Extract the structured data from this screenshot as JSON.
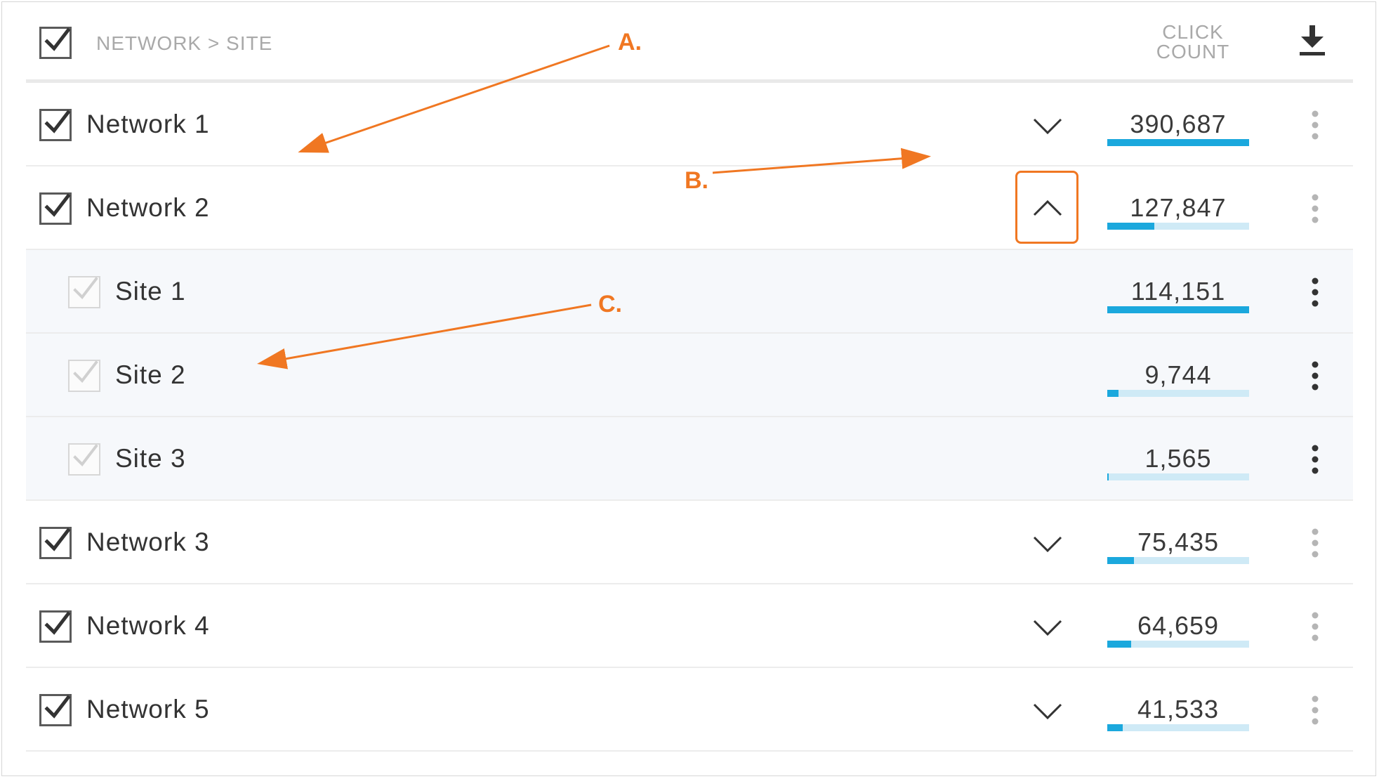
{
  "header": {
    "breadcrumb": "NETWORK > SITE",
    "count_line1": "CLICK",
    "count_line2": "COUNT",
    "download_icon": "download-icon"
  },
  "rows": [
    {
      "label": "Network 1",
      "count": "390,687",
      "share": 1.0,
      "type": "network",
      "expanded": false
    },
    {
      "label": "Network 2",
      "count": "127,847",
      "share": 0.33,
      "type": "network",
      "expanded": true
    },
    {
      "label": "Site 1",
      "count": "114,151",
      "share": 1.0,
      "type": "site"
    },
    {
      "label": "Site 2",
      "count": "9,744",
      "share": 0.08,
      "type": "site"
    },
    {
      "label": "Site 3",
      "count": "1,565",
      "share": 0.01,
      "type": "site"
    },
    {
      "label": "Network 3",
      "count": "75,435",
      "share": 0.19,
      "type": "network",
      "expanded": false
    },
    {
      "label": "Network 4",
      "count": "64,659",
      "share": 0.17,
      "type": "network",
      "expanded": false
    },
    {
      "label": "Network 5",
      "count": "41,533",
      "share": 0.11,
      "type": "network",
      "expanded": false
    }
  ],
  "annotations": {
    "a": "A.",
    "b": "B.",
    "c": "C."
  },
  "colors": {
    "accent_orange": "#f07722",
    "bar_fill": "#1ba8dd",
    "bar_track": "#cfeaf6"
  }
}
